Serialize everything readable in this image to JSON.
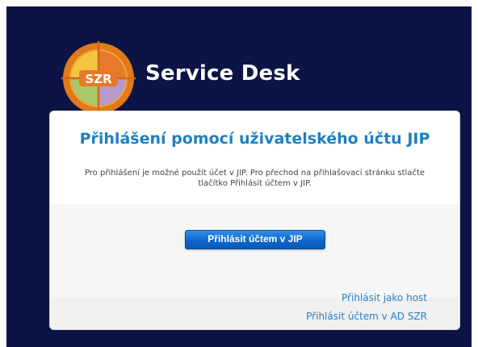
{
  "header": {
    "logo_text": "SZR",
    "brand_name": "Service Desk"
  },
  "login_panel": {
    "title": "Přihlášení pomocí uživatelského účtu JIP",
    "description": "Pro přihlášení je možné použít účet v JIP. Pro přechod na přihlašovací stránku stlačte tlačítko Přihlásit účtem v JIP.",
    "login_button_label": "Přihlásit účtem v JIP",
    "guest_link_label": "Přihlásit jako host",
    "ad_link_label": "Přihlásit účtem v AD SZR"
  },
  "colors": {
    "page_background": "#0c1445",
    "title_color": "#1f80bf",
    "button_color": "#1066cc",
    "link_color": "#2a7fc2"
  }
}
